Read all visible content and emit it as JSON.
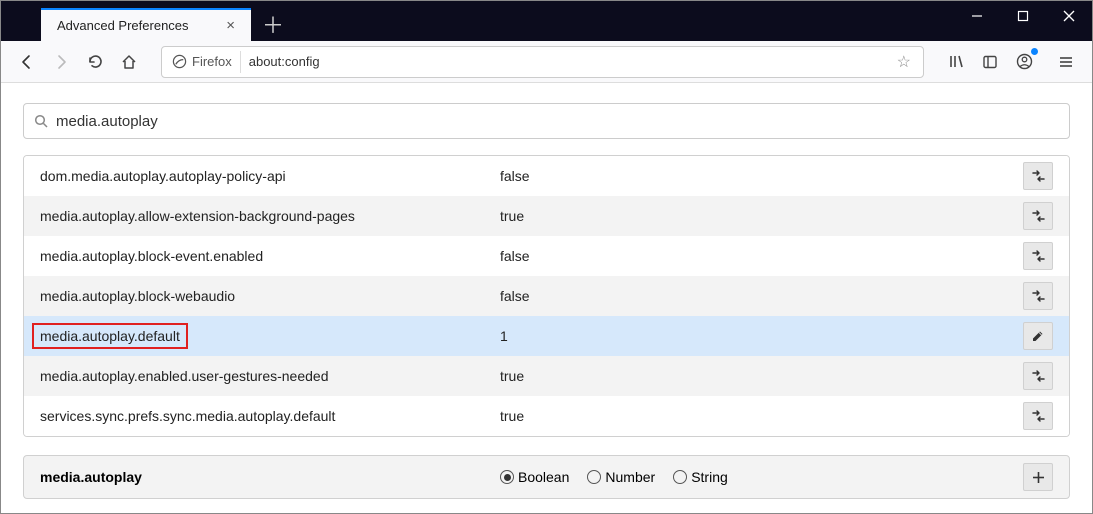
{
  "window": {
    "tab_title": "Advanced Preferences",
    "identity_label": "Firefox",
    "url": "about:config"
  },
  "search": {
    "value": "media.autoplay"
  },
  "prefs": [
    {
      "name": "dom.media.autoplay.autoplay-policy-api",
      "value": "false",
      "action": "toggle",
      "selected": false,
      "highlight": false
    },
    {
      "name": "media.autoplay.allow-extension-background-pages",
      "value": "true",
      "action": "toggle",
      "selected": false,
      "highlight": false
    },
    {
      "name": "media.autoplay.block-event.enabled",
      "value": "false",
      "action": "toggle",
      "selected": false,
      "highlight": false
    },
    {
      "name": "media.autoplay.block-webaudio",
      "value": "false",
      "action": "toggle",
      "selected": false,
      "highlight": false
    },
    {
      "name": "media.autoplay.default",
      "value": "1",
      "action": "edit",
      "selected": true,
      "highlight": true
    },
    {
      "name": "media.autoplay.enabled.user-gestures-needed",
      "value": "true",
      "action": "toggle",
      "selected": false,
      "highlight": false
    },
    {
      "name": "services.sync.prefs.sync.media.autoplay.default",
      "value": "true",
      "action": "toggle",
      "selected": false,
      "highlight": false
    }
  ],
  "add_row": {
    "name": "media.autoplay",
    "options": [
      "Boolean",
      "Number",
      "String"
    ],
    "selected": "Boolean"
  }
}
